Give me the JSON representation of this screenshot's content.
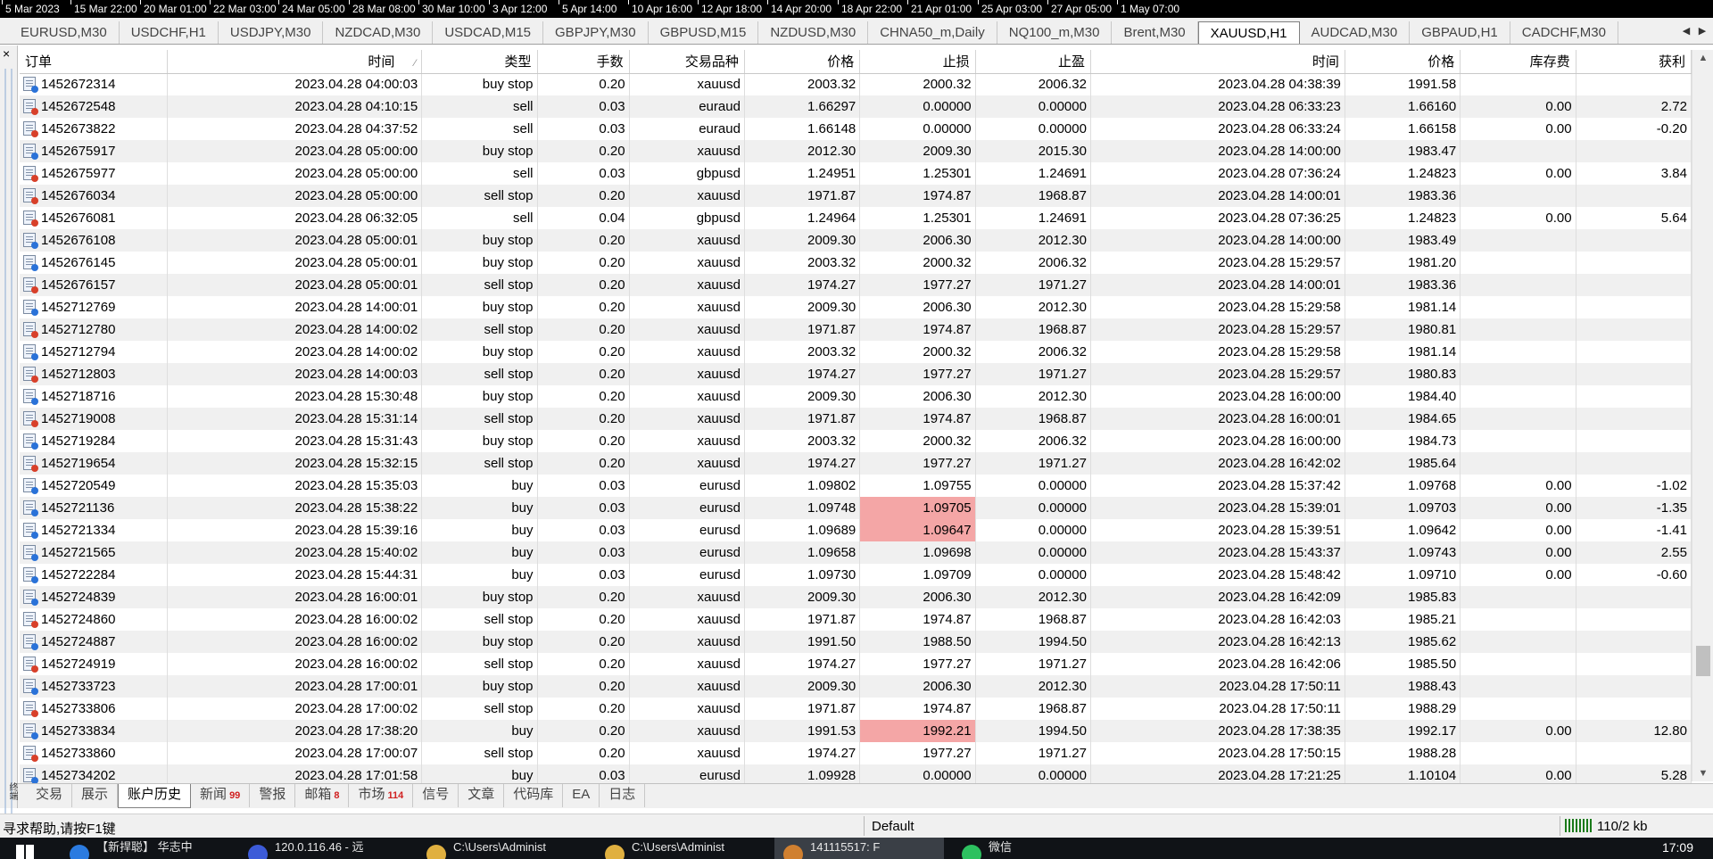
{
  "timeline": [
    "5 Mar 2023",
    "15 Mar 22:00",
    "20 Mar 01:00",
    "22 Mar 03:00",
    "24 Mar 05:00",
    "28 Mar 08:00",
    "30 Mar 10:00",
    "3 Apr 12:00",
    "5 Apr 14:00",
    "10 Apr 16:00",
    "12 Apr 18:00",
    "14 Apr 20:00",
    "18 Apr 22:00",
    "21 Apr 01:00",
    "25 Apr 03:00",
    "27 Apr 05:00",
    "1 May 07:00"
  ],
  "chart_tabs": [
    "EURUSD,M30",
    "USDCHF,H1",
    "USDJPY,M30",
    "NZDCAD,M30",
    "USDCAD,M15",
    "GBPJPY,M30",
    "GBPUSD,M15",
    "NZDUSD,M30",
    "CHNA50_m,Daily",
    "NQ100_m,M30",
    "Brent,M30",
    "XAUUSD,H1",
    "AUDCAD,M30",
    "GBPAUD,H1",
    "CADCHF,M30"
  ],
  "active_chart_tab": "XAUUSD,H1",
  "close_symbol": "×",
  "panel_vertical_label": "终端",
  "columns": [
    "订单",
    "时间",
    "类型",
    "手数",
    "交易品种",
    "价格",
    "止损",
    "止盈",
    "时间",
    "价格",
    "库存费",
    "获利"
  ],
  "sort_indicator": "⁄",
  "rows": [
    [
      "1452672314",
      "2023.04.28 04:00:03",
      "buy stop",
      "0.20",
      "xauusd",
      "2003.32",
      "2000.32",
      "2006.32",
      "2023.04.28 04:38:39",
      "1991.58",
      "",
      ""
    ],
    [
      "1452672548",
      "2023.04.28 04:10:15",
      "sell",
      "0.03",
      "euraud",
      "1.66297",
      "0.00000",
      "0.00000",
      "2023.04.28 06:33:23",
      "1.66160",
      "0.00",
      "2.72"
    ],
    [
      "1452673822",
      "2023.04.28 04:37:52",
      "sell",
      "0.03",
      "euraud",
      "1.66148",
      "0.00000",
      "0.00000",
      "2023.04.28 06:33:24",
      "1.66158",
      "0.00",
      "-0.20"
    ],
    [
      "1452675917",
      "2023.04.28 05:00:00",
      "buy stop",
      "0.20",
      "xauusd",
      "2012.30",
      "2009.30",
      "2015.30",
      "2023.04.28 14:00:00",
      "1983.47",
      "",
      ""
    ],
    [
      "1452675977",
      "2023.04.28 05:00:00",
      "sell",
      "0.03",
      "gbpusd",
      "1.24951",
      "1.25301",
      "1.24691",
      "2023.04.28 07:36:24",
      "1.24823",
      "0.00",
      "3.84"
    ],
    [
      "1452676034",
      "2023.04.28 05:00:00",
      "sell stop",
      "0.20",
      "xauusd",
      "1971.87",
      "1974.87",
      "1968.87",
      "2023.04.28 14:00:01",
      "1983.36",
      "",
      ""
    ],
    [
      "1452676081",
      "2023.04.28 06:32:05",
      "sell",
      "0.04",
      "gbpusd",
      "1.24964",
      "1.25301",
      "1.24691",
      "2023.04.28 07:36:25",
      "1.24823",
      "0.00",
      "5.64"
    ],
    [
      "1452676108",
      "2023.04.28 05:00:01",
      "buy stop",
      "0.20",
      "xauusd",
      "2009.30",
      "2006.30",
      "2012.30",
      "2023.04.28 14:00:00",
      "1983.49",
      "",
      ""
    ],
    [
      "1452676145",
      "2023.04.28 05:00:01",
      "buy stop",
      "0.20",
      "xauusd",
      "2003.32",
      "2000.32",
      "2006.32",
      "2023.04.28 15:29:57",
      "1981.20",
      "",
      ""
    ],
    [
      "1452676157",
      "2023.04.28 05:00:01",
      "sell stop",
      "0.20",
      "xauusd",
      "1974.27",
      "1977.27",
      "1971.27",
      "2023.04.28 14:00:01",
      "1983.36",
      "",
      ""
    ],
    [
      "1452712769",
      "2023.04.28 14:00:01",
      "buy stop",
      "0.20",
      "xauusd",
      "2009.30",
      "2006.30",
      "2012.30",
      "2023.04.28 15:29:58",
      "1981.14",
      "",
      ""
    ],
    [
      "1452712780",
      "2023.04.28 14:00:02",
      "sell stop",
      "0.20",
      "xauusd",
      "1971.87",
      "1974.87",
      "1968.87",
      "2023.04.28 15:29:57",
      "1980.81",
      "",
      ""
    ],
    [
      "1452712794",
      "2023.04.28 14:00:02",
      "buy stop",
      "0.20",
      "xauusd",
      "2003.32",
      "2000.32",
      "2006.32",
      "2023.04.28 15:29:58",
      "1981.14",
      "",
      ""
    ],
    [
      "1452712803",
      "2023.04.28 14:00:03",
      "sell stop",
      "0.20",
      "xauusd",
      "1974.27",
      "1977.27",
      "1971.27",
      "2023.04.28 15:29:57",
      "1980.83",
      "",
      ""
    ],
    [
      "1452718716",
      "2023.04.28 15:30:48",
      "buy stop",
      "0.20",
      "xauusd",
      "2009.30",
      "2006.30",
      "2012.30",
      "2023.04.28 16:00:00",
      "1984.40",
      "",
      ""
    ],
    [
      "1452719008",
      "2023.04.28 15:31:14",
      "sell stop",
      "0.20",
      "xauusd",
      "1971.87",
      "1974.87",
      "1968.87",
      "2023.04.28 16:00:01",
      "1984.65",
      "",
      ""
    ],
    [
      "1452719284",
      "2023.04.28 15:31:43",
      "buy stop",
      "0.20",
      "xauusd",
      "2003.32",
      "2000.32",
      "2006.32",
      "2023.04.28 16:00:00",
      "1984.73",
      "",
      ""
    ],
    [
      "1452719654",
      "2023.04.28 15:32:15",
      "sell stop",
      "0.20",
      "xauusd",
      "1974.27",
      "1977.27",
      "1971.27",
      "2023.04.28 16:42:02",
      "1985.64",
      "",
      ""
    ],
    [
      "1452720549",
      "2023.04.28 15:35:03",
      "buy",
      "0.03",
      "eurusd",
      "1.09802",
      "1.09755",
      "0.00000",
      "2023.04.28 15:37:42",
      "1.09768",
      "0.00",
      "-1.02"
    ],
    [
      "1452721136",
      "2023.04.28 15:38:22",
      "buy",
      "0.03",
      "eurusd",
      "1.09748",
      "1.09705",
      "0.00000",
      "2023.04.28 15:39:01",
      "1.09703",
      "0.00",
      "-1.35"
    ],
    [
      "1452721334",
      "2023.04.28 15:39:16",
      "buy",
      "0.03",
      "eurusd",
      "1.09689",
      "1.09647",
      "0.00000",
      "2023.04.28 15:39:51",
      "1.09642",
      "0.00",
      "-1.41"
    ],
    [
      "1452721565",
      "2023.04.28 15:40:02",
      "buy",
      "0.03",
      "eurusd",
      "1.09658",
      "1.09698",
      "0.00000",
      "2023.04.28 15:43:37",
      "1.09743",
      "0.00",
      "2.55"
    ],
    [
      "1452722284",
      "2023.04.28 15:44:31",
      "buy",
      "0.03",
      "eurusd",
      "1.09730",
      "1.09709",
      "0.00000",
      "2023.04.28 15:48:42",
      "1.09710",
      "0.00",
      "-0.60"
    ],
    [
      "1452724839",
      "2023.04.28 16:00:01",
      "buy stop",
      "0.20",
      "xauusd",
      "2009.30",
      "2006.30",
      "2012.30",
      "2023.04.28 16:42:09",
      "1985.83",
      "",
      ""
    ],
    [
      "1452724860",
      "2023.04.28 16:00:02",
      "sell stop",
      "0.20",
      "xauusd",
      "1971.87",
      "1974.87",
      "1968.87",
      "2023.04.28 16:42:03",
      "1985.21",
      "",
      ""
    ],
    [
      "1452724887",
      "2023.04.28 16:00:02",
      "buy stop",
      "0.20",
      "xauusd",
      "1991.50",
      "1988.50",
      "1994.50",
      "2023.04.28 16:42:13",
      "1985.62",
      "",
      ""
    ],
    [
      "1452724919",
      "2023.04.28 16:00:02",
      "sell stop",
      "0.20",
      "xauusd",
      "1974.27",
      "1977.27",
      "1971.27",
      "2023.04.28 16:42:06",
      "1985.50",
      "",
      ""
    ],
    [
      "1452733723",
      "2023.04.28 17:00:01",
      "buy stop",
      "0.20",
      "xauusd",
      "2009.30",
      "2006.30",
      "2012.30",
      "2023.04.28 17:50:11",
      "1988.43",
      "",
      ""
    ],
    [
      "1452733806",
      "2023.04.28 17:00:02",
      "sell stop",
      "0.20",
      "xauusd",
      "1971.87",
      "1974.87",
      "1968.87",
      "2023.04.28 17:50:11",
      "1988.29",
      "",
      ""
    ],
    [
      "1452733834",
      "2023.04.28 17:38:20",
      "buy",
      "0.20",
      "xauusd",
      "1991.53",
      "1992.21",
      "1994.50",
      "2023.04.28 17:38:35",
      "1992.17",
      "0.00",
      "12.80"
    ],
    [
      "1452733860",
      "2023.04.28 17:00:07",
      "sell stop",
      "0.20",
      "xauusd",
      "1974.27",
      "1977.27",
      "1971.27",
      "2023.04.28 17:50:15",
      "1988.28",
      "",
      ""
    ],
    [
      "1452734202",
      "2023.04.28 17:01:58",
      "buy",
      "0.03",
      "eurusd",
      "1.09928",
      "0.00000",
      "0.00000",
      "2023.04.28 17:21:25",
      "1.10104",
      "0.00",
      "5.28"
    ]
  ],
  "highlighted_sl_orders": [
    "1452721136",
    "1452721334",
    "1452733834"
  ],
  "highlight_color": "#f4a6a6",
  "bottom_tabs": [
    {
      "label": "交易",
      "badge": ""
    },
    {
      "label": "展示",
      "badge": ""
    },
    {
      "label": "账户历史",
      "badge": ""
    },
    {
      "label": "新闻",
      "badge": "99"
    },
    {
      "label": "警报",
      "badge": ""
    },
    {
      "label": "邮箱",
      "badge": "8"
    },
    {
      "label": "市场",
      "badge": "114"
    },
    {
      "label": "信号",
      "badge": ""
    },
    {
      "label": "文章",
      "badge": ""
    },
    {
      "label": "代码库",
      "badge": ""
    },
    {
      "label": "EA",
      "badge": ""
    },
    {
      "label": "日志",
      "badge": ""
    }
  ],
  "active_bottom_tab": "账户历史",
  "status": {
    "help": "寻求帮助,请按F1键",
    "profile": "Default",
    "traffic": "110/2 kb"
  },
  "taskbar": {
    "items": [
      "【新捍聪】 华志中",
      "120.0.116.46 - 远",
      "C:\\Users\\Administ",
      "C:\\Users\\Administ",
      "141115517: F",
      "微信"
    ],
    "clock": "17:09"
  }
}
